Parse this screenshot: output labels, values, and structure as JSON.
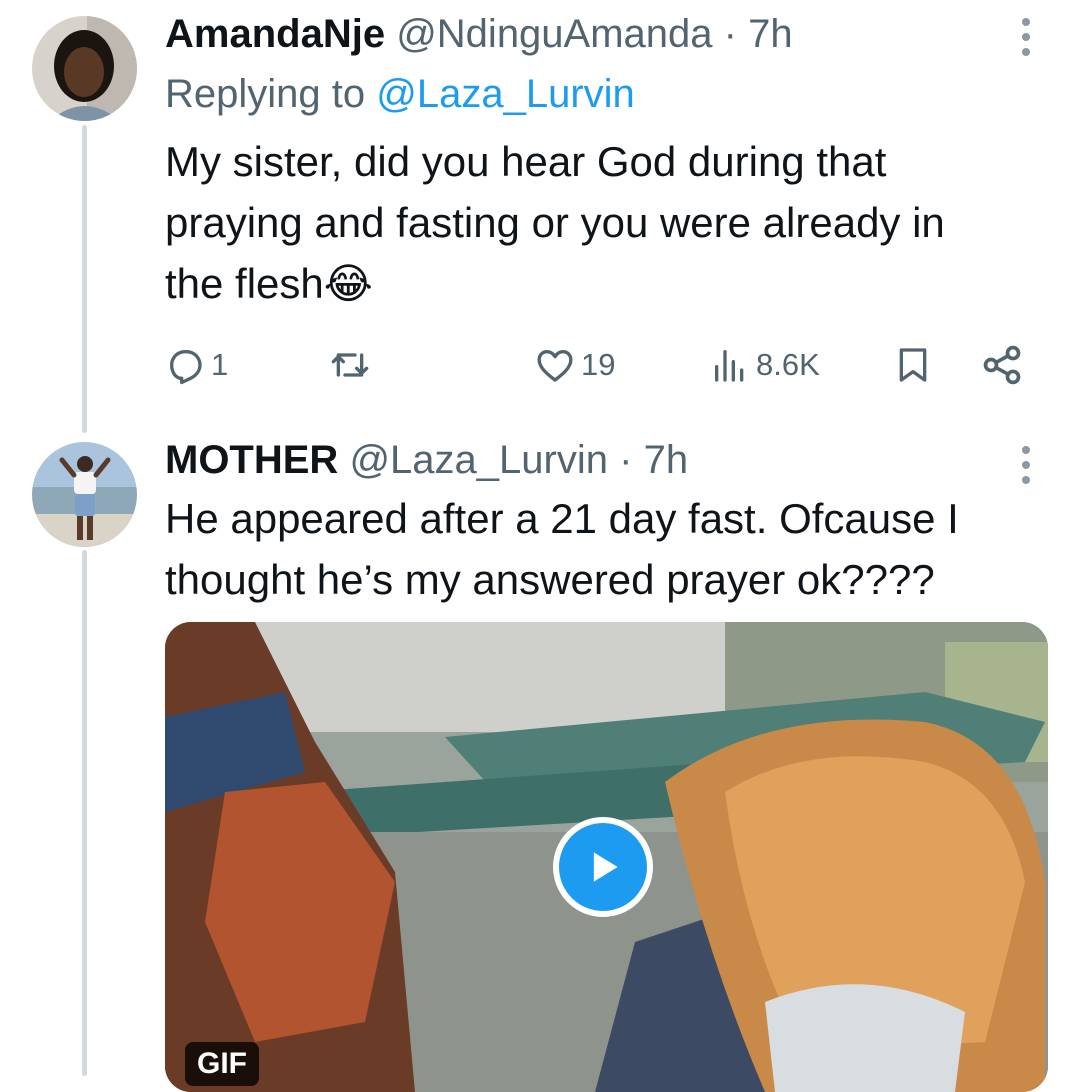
{
  "tweets": [
    {
      "display_name": "AmandaNje",
      "handle": "@NdinguAmanda",
      "separator": "·",
      "time": "7h",
      "replying_prefix": "Replying to",
      "replying_to": "@Laza_Lurvin",
      "text_lines": [
        "My sister, did you hear God during that",
        "praying and fasting or you were already in",
        "the flesh😂"
      ],
      "actions": {
        "reply_count": "1",
        "like_count": "19",
        "views_count": "8.6K"
      }
    },
    {
      "display_name": "MOTHER",
      "handle": "@Laza_Lurvin",
      "separator": "·",
      "time": "7h",
      "text_lines": [
        "He appeared after a 21 day fast. Ofcause  I",
        "thought he’s my answered prayer ok????"
      ],
      "media": {
        "badge": "GIF"
      }
    }
  ],
  "icons": {
    "more": "more-vertical-icon",
    "reply": "reply-icon",
    "retweet": "retweet-icon",
    "like": "heart-icon",
    "views": "views-icon",
    "bookmark": "bookmark-icon",
    "share": "share-icon",
    "play": "play-icon"
  },
  "colors": {
    "accent": "#1d9bf0",
    "secondary_text": "#536471",
    "thread_line": "#cfd9de"
  }
}
